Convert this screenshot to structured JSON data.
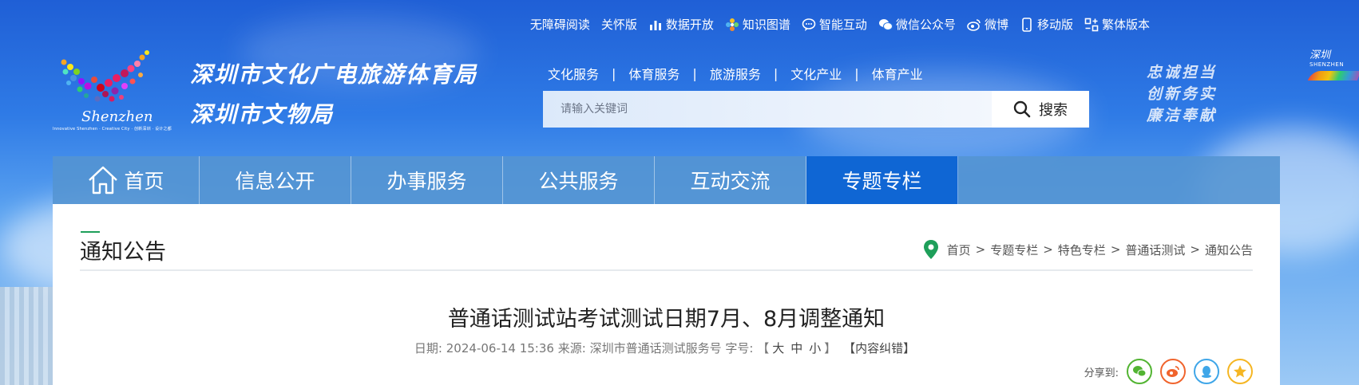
{
  "top_links": [
    {
      "label": "无障碍阅读",
      "icon": ""
    },
    {
      "label": "关怀版",
      "icon": ""
    },
    {
      "label": "数据开放",
      "icon": "bar-chart-icon"
    },
    {
      "label": "知识图谱",
      "icon": "flower-icon"
    },
    {
      "label": "智能互动",
      "icon": "chat-icon"
    },
    {
      "label": "微信公众号",
      "icon": "wechat-icon"
    },
    {
      "label": "微博",
      "icon": "weibo-icon"
    },
    {
      "label": "移动版",
      "icon": "mobile-icon"
    },
    {
      "label": "繁体版本",
      "icon": "traditional-icon"
    }
  ],
  "logo": {
    "en": "Shenzhen",
    "slogan": "Innovative Shenzhen · Creative City · 创新深圳 · 设计之都"
  },
  "org": {
    "line1": "深圳市文化广电旅游体育局",
    "line2": "深圳市文物局"
  },
  "subnav": [
    "文化服务",
    "体育服务",
    "旅游服务",
    "文化产业",
    "体育产业"
  ],
  "subnav_sep": "|",
  "search": {
    "placeholder": "请输入关键词",
    "button_label": "搜索"
  },
  "motto": [
    "忠诚担当",
    "创新务实",
    "廉洁奉献"
  ],
  "right_logo": {
    "title": "深圳",
    "subtitle": "SHENZHEN"
  },
  "mainnav": [
    {
      "label": "首页",
      "active": false
    },
    {
      "label": "信息公开",
      "active": false
    },
    {
      "label": "办事服务",
      "active": false
    },
    {
      "label": "公共服务",
      "active": false
    },
    {
      "label": "互动交流",
      "active": false
    },
    {
      "label": "专题专栏",
      "active": true
    }
  ],
  "section_title": "通知公告",
  "breadcrumb": [
    "首页",
    "专题专栏",
    "特色专栏",
    "普通话测试",
    "通知公告"
  ],
  "breadcrumb_sep": ">",
  "article": {
    "title": "普通话测试站考试测试日期7月、8月调整通知",
    "date_label": "日期:",
    "date": "2024-06-14 15:36",
    "source_label": "来源:",
    "source": "深圳市普通话测试服务号",
    "font_label": "字号:",
    "font_sizes": [
      "大",
      "中",
      "小"
    ],
    "correction": "【内容纠错】"
  },
  "share": {
    "label": "分享到:",
    "targets": [
      "wechat",
      "weibo",
      "qq",
      "qzone"
    ]
  },
  "colors": {
    "nav_active": "#0f66d4",
    "nav_bg": "#5494d2",
    "accent_green": "#1e9f5a",
    "pin_green": "#1e9f5a"
  }
}
